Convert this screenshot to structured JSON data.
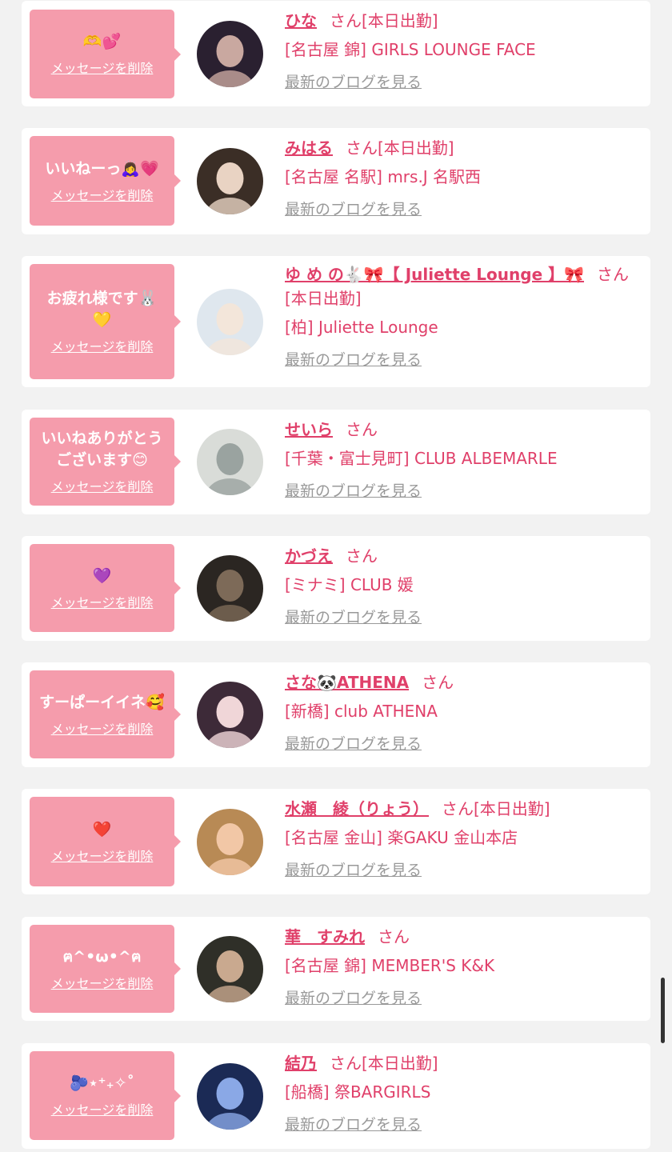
{
  "delete_label": "メッセージを削除",
  "blog_label": "最新のブログを見る",
  "san_label": "さん",
  "colors": {
    "accent": "#e0406a",
    "bubble": "#f59cac",
    "link_gray": "#999999",
    "background": "#f2f2f2"
  },
  "items": [
    {
      "message": "🫶💕",
      "name": "ひな",
      "name_suffix": "さん[本日出勤]",
      "shop": "[名古屋 錦] GIRLS LOUNGE FACE"
    },
    {
      "message": "いいねーっ🙇‍♀️💗",
      "name": "みはる",
      "name_suffix": "さん[本日出勤]",
      "shop": "[名古屋 名駅] mrs.J 名駅西"
    },
    {
      "message": "お疲れ様です🐰\n💛",
      "name": "ゆ め の🐇🎀【 Juliette Lounge 】🎀",
      "name_suffix": "さん",
      "name_extra": "[本日出勤]",
      "shop": "[柏] Juliette Lounge"
    },
    {
      "message": "いいねありがとう\nございます😊",
      "name": "せいら",
      "name_suffix": "さん",
      "shop": "[千葉・富士見町] CLUB ALBEMARLE"
    },
    {
      "message": "💜",
      "name": "かづえ",
      "name_suffix": "さん",
      "shop": "[ミナミ] CLUB 媛"
    },
    {
      "message": "すーぱーイイネ🥰",
      "name": "さな🐼ATHENA",
      "name_suffix": "さん",
      "shop": "[新橋] club ATHENA"
    },
    {
      "message": "❤️",
      "name": "水瀬　綾（りょう）",
      "name_suffix": "さん[本日出勤]",
      "shop": "[名古屋 金山] 楽GAKU 金山本店"
    },
    {
      "message": "ฅ^•ω•^ฅ",
      "name": "華　すみれ",
      "name_suffix": "さん",
      "shop": "[名古屋 錦] MEMBER'S K&K"
    },
    {
      "message": "🫐⋆⁺₊✧˚",
      "name": "結乃",
      "name_suffix": "さん[本日出勤]",
      "shop": "[船橋] 祭BARGIRLS"
    }
  ]
}
